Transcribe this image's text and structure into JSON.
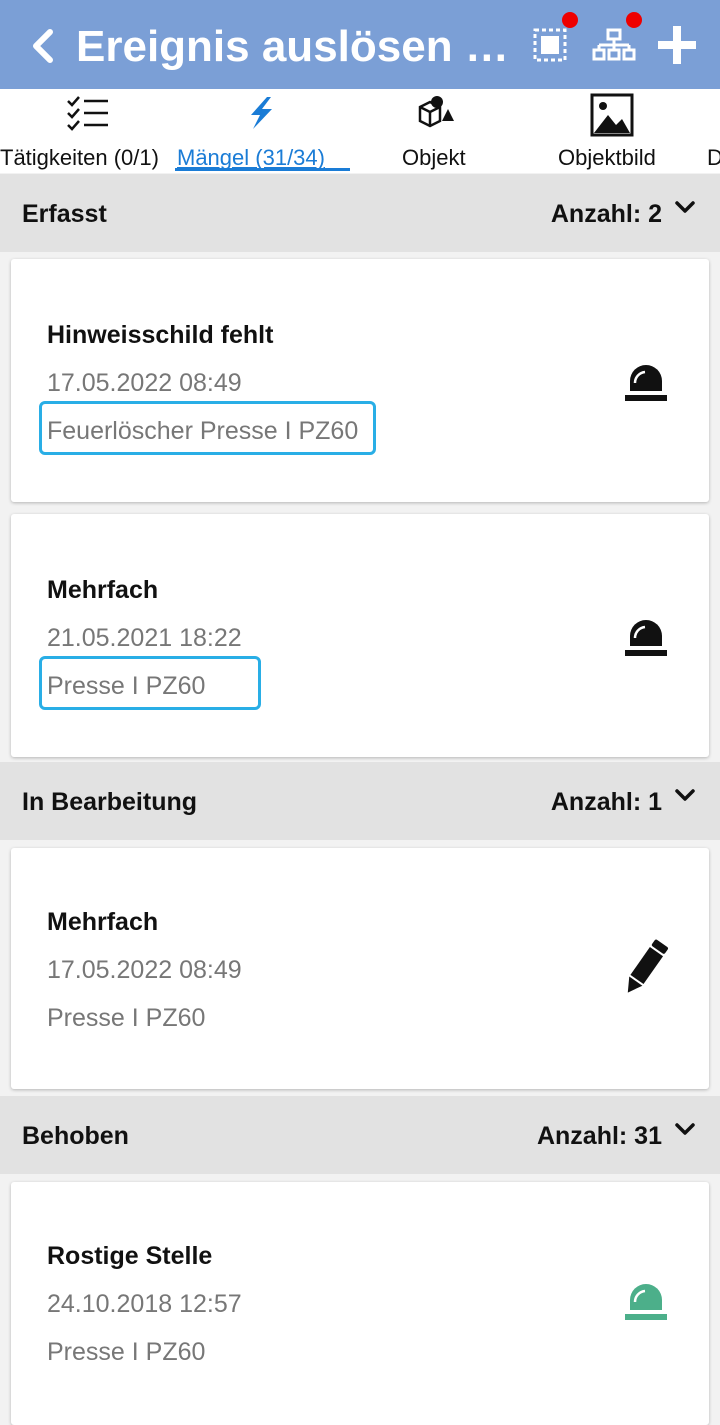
{
  "header": {
    "title": "Ereignis auslösen P..."
  },
  "tabs": [
    {
      "label": "Tätigkeiten (0/1)",
      "icon": "checklist-icon"
    },
    {
      "label": "Mängel (31/34)",
      "icon": "lightning-icon",
      "active": true
    },
    {
      "label": "Objekt",
      "icon": "objects-icon"
    },
    {
      "label": "Objektbild",
      "icon": "image-icon"
    },
    {
      "label": "D",
      "icon": ""
    }
  ],
  "sections": [
    {
      "title": "Erfasst",
      "count": "Anzahl: 2",
      "cards": [
        {
          "title": "Hinweisschild fehlt",
          "date": "17.05.2022 08:49",
          "object": "Feuerlöscher Presse I PZ60",
          "status_icon": "alarm-light-icon"
        },
        {
          "title": "Mehrfach",
          "date": "21.05.2021 18:22",
          "object": "Presse I PZ60",
          "status_icon": "alarm-light-icon"
        }
      ]
    },
    {
      "title": "In Bearbeitung",
      "count": "Anzahl: 1",
      "cards": [
        {
          "title": "Mehrfach",
          "date": "17.05.2022 08:49",
          "object": "Presse I PZ60",
          "status_icon": "pencil-icon"
        }
      ]
    },
    {
      "title": "Behoben",
      "count": "Anzahl: 31",
      "cards": [
        {
          "title": "Rostige Stelle",
          "date": "24.10.2018 12:57",
          "object": "Presse I PZ60",
          "status_icon": "alarm-light-icon"
        }
      ]
    }
  ],
  "colors": {
    "appbar": "#7b9fd6",
    "accent": "#1a7cd6",
    "highlight": "#29aee6",
    "resolved": "#4caf8a"
  }
}
